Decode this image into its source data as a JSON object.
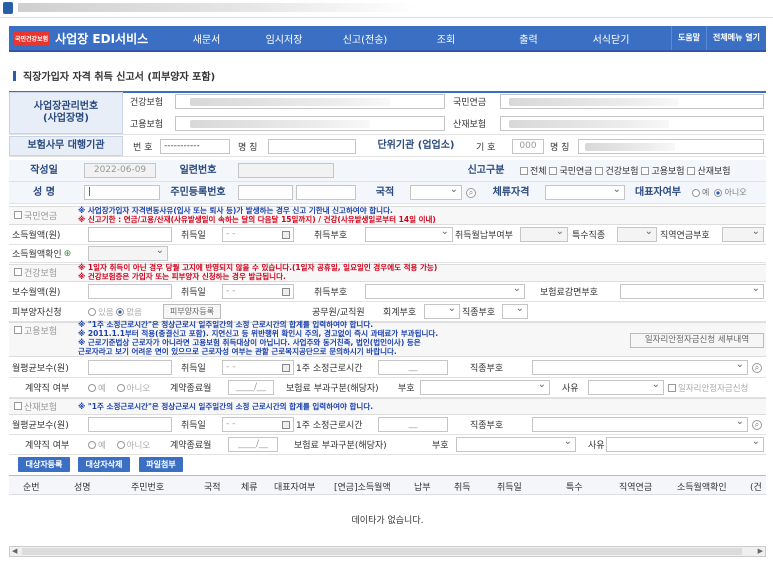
{
  "menu": {
    "logo": "국민건강보험",
    "title": "사업장 EDI서비스",
    "items": [
      "새문서",
      "임시저장",
      "신고(전송)",
      "조회",
      "출력",
      "서식닫기"
    ],
    "help": "도움말",
    "all_menu": "전체메뉴 열기"
  },
  "page_title": "직장가입자 자격 취득 신고서 (피부양자 포함)",
  "biz": {
    "label": "사업장관리번호\n(사업장명)",
    "health": "건강보험",
    "employ": "고용보험",
    "pension": "국민연금",
    "industrial": "산재보험"
  },
  "agent": {
    "label": "보험사무 대행기관",
    "no_label": "번 호",
    "no_value": "-----------",
    "name_label": "명 칭",
    "unit_label": "단위기관 (업업소)",
    "code_label": "기 호",
    "code_value": "000",
    "name2_label": "명 칭"
  },
  "form": {
    "date_label": "작성일",
    "date_value": "2022-06-09",
    "serial_label": "일련번호",
    "report_type_label": "신고구분",
    "report_types": [
      "전체",
      "국민연금",
      "건강보험",
      "고용보험",
      "산재보험"
    ],
    "name_label": "성 명",
    "rrn_label": "주민등록번호",
    "nation_label": "국적",
    "stay_label": "체류자격",
    "rep_label": "대표자여부",
    "yes": "예",
    "no": "아니오"
  },
  "pension": {
    "section": "국민연금",
    "note1": "※ 사업장가입자 자격변동사유(입사 또는 퇴사 등)가 발생하는 경우 신고 기한내 신고하여야 합니다.",
    "note2": "※ 신고기한 : 연금/고용/산재(사유발생일이 속하는 달의 다음달 15일까지) / 건강(사유발생일로부터 14일 이내)",
    "income_label": "소득월액(원)",
    "acq_date_label": "취득일",
    "date_ph": "- -",
    "acq_code_label": "취득부호",
    "pay_label": "취득월납부여부",
    "special_label": "특수직종",
    "occ_label": "직역연금부호",
    "income_check_label": "소득월액확인"
  },
  "health": {
    "section": "건강보험",
    "note1": "※ 1일자 취득이 아닌 경우 당월 고지에 반영되지 않을 수 있습니다.(1일자 공휴일, 일요일인 경우에도 적용 가능)",
    "note2": "※ 건강보험증은 가입자 또는 피부양자 신청하는 경우 발급됩니다.",
    "pay_label": "보수월액(원)",
    "acq_date_label": "취득일",
    "acq_code_label": "취득부호",
    "reduce_label": "보험료감면부호",
    "dependent_label": "피부양자신청",
    "has": "있음",
    "none": "없음",
    "dep_reg": "피부양자등록",
    "official_label": "공무원/교직원",
    "account_label": "회계부호",
    "job_label": "직종부호"
  },
  "employ": {
    "section": "고용보험",
    "note1": "※ \"1주 소정근로시간\"은 정상근로시 일주일간의 소정 근로시간의 합계를 입력하여야 합니다.",
    "note2": "※ 2011.1.1부터 적용(종결신고 포함). 지연신고 등 위반행위 확인시 주의, 경고없이 즉시 과태료가 부과됩니다.",
    "note3": "※ 근로기준법상 근로자가 아니라면 고용보험 취득대상이 아닙니다. 사업주와 동거친족, 법인(법인이사) 등은",
    "note4": "   근로자라고 보기 어려운 면이 있으므로 근로자성 여부는 관할 근로복지공단으로 문의하시기 바랍니다.",
    "support_btn": "일자리안정자금신청 세부내역",
    "avg_pay_label": "월평균보수(원)",
    "acq_date_label": "취득일",
    "hours_label": "1주 소정근로시간",
    "job_label": "직종부호",
    "contract_label": "계약직 여부",
    "contract_end_label": "계약종료월",
    "contract_end_ph": "____/__",
    "levy_label": "보험료 부과구분(해당자)",
    "code_label": "부호",
    "reason_label": "사유",
    "support_label": "일자리안정자금신청"
  },
  "industrial": {
    "section": "산재보험",
    "note1": "※ \"1주 소정근로시간\"은 정상근로시 일주일간의 소정 근로시간의 합계를 입력하여야 합니다.",
    "avg_pay_label": "월평균보수(원)",
    "acq_date_label": "취득일",
    "hours_label": "1주 소정근로시간",
    "job_label": "직종부호",
    "contract_label": "계약직 여부",
    "contract_end_label": "계약종료월",
    "contract_end_ph": "____/__",
    "levy_label": "보험료 부과구분(해당자)",
    "code_label": "부호",
    "reason_label": "사유"
  },
  "buttons": [
    "대상자등록",
    "대상자삭제",
    "파일첨부"
  ],
  "grid": {
    "columns": [
      "순번",
      "성명",
      "주민번호",
      "국적",
      "체류",
      "대표자여부",
      "[연금]소득월액",
      "납부",
      "취득",
      "취득일",
      "특수",
      "직역연금",
      "소득월액확인",
      "(건"
    ],
    "empty": "데이타가 없습니다."
  }
}
